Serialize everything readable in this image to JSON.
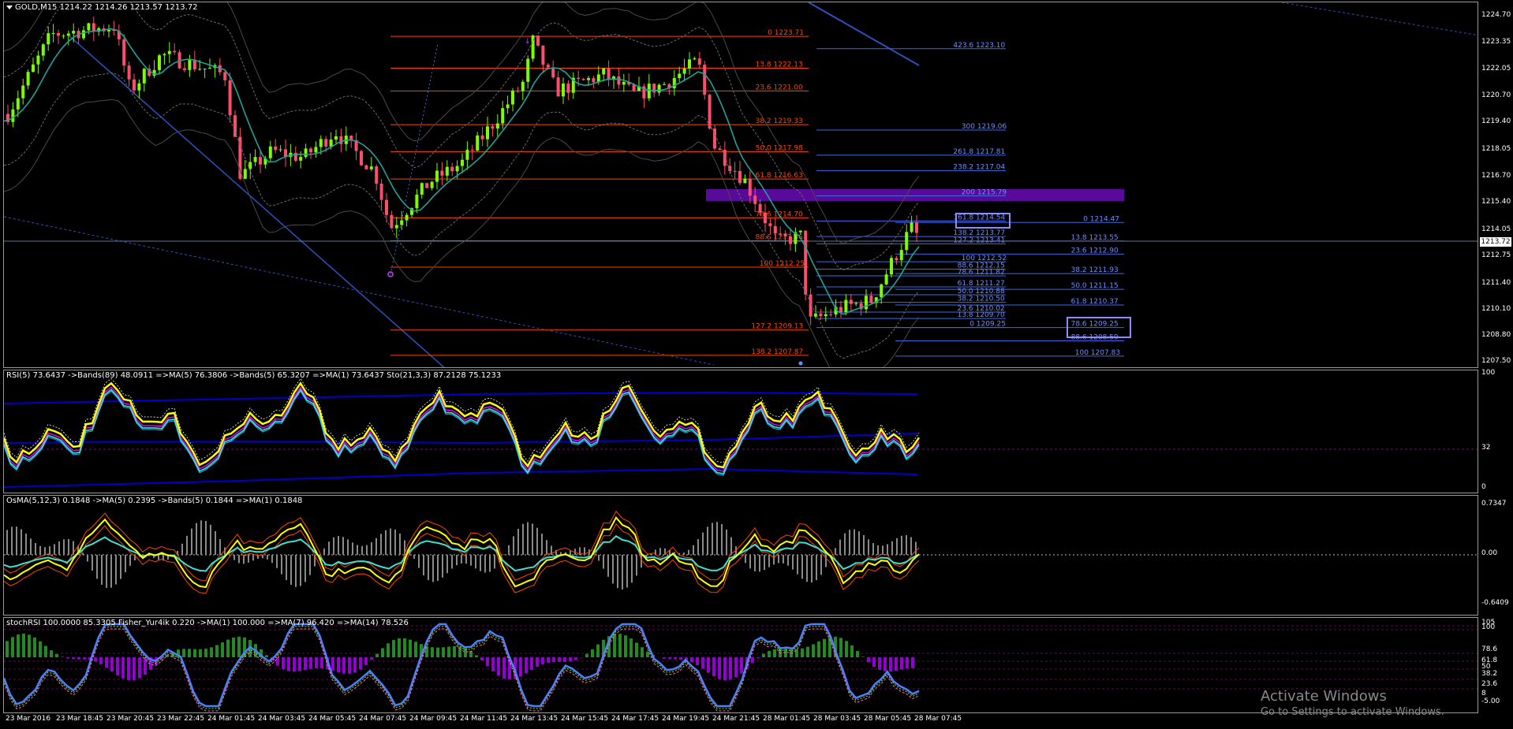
{
  "chart_header": "GOLD,M15  1214.22 1214.26 1213.57 1213.72",
  "current_price": "1213.72",
  "price_axis": [
    "1224.70",
    "1223.35",
    "1222.05",
    "1220.70",
    "1219.40",
    "1218.05",
    "1216.70",
    "1215.40",
    "1214.05",
    "1212.75",
    "1211.40",
    "1210.10",
    "1208.80",
    "1207.50"
  ],
  "fib_orange": [
    {
      "label": "0 1223.71"
    },
    {
      "label": "13.8 1222.13"
    },
    {
      "label": "23.6 1221.00"
    },
    {
      "label": "38.2 1219.33"
    },
    {
      "label": "50.0 1217.98"
    },
    {
      "label": "61.8 1216.63"
    },
    {
      "label": "78.6 1214.70"
    },
    {
      "label": "88.6 1213.56"
    },
    {
      "label": "100 1212.25"
    },
    {
      "label": "127.2 1209.13"
    },
    {
      "label": "138.2 1207.87"
    }
  ],
  "fib_blue_upper": [
    {
      "label": "423.6 1223.10"
    },
    {
      "label": "300 1219.06"
    },
    {
      "label": "261.8 1217.81"
    },
    {
      "label": "238.2 1217.04"
    },
    {
      "label": "200 1215.79"
    },
    {
      "label": "161.8 1214.54"
    },
    {
      "label": "138.2 1213.77"
    },
    {
      "label": "127.2 1213.41"
    },
    {
      "label": "100 1212.52"
    },
    {
      "label": "88.6 1212.15"
    },
    {
      "label": "78.6 1211.82"
    },
    {
      "label": "61.8 1211.27"
    },
    {
      "label": "50.0 1210.88"
    },
    {
      "label": "38.2 1210.50"
    },
    {
      "label": "23.6 1210.02"
    },
    {
      "label": "13.8 1209.70"
    },
    {
      "label": "0 1209.25"
    }
  ],
  "fib_blue_right": [
    {
      "label": "0 1214.47"
    },
    {
      "label": "13.8 1213.55"
    },
    {
      "label": "23.6 1212.90"
    },
    {
      "label": "38.2 1211.93"
    },
    {
      "label": "50.0 1211.15"
    },
    {
      "label": "61.8 1210.37"
    },
    {
      "label": "78.6 1209.25"
    },
    {
      "label": "88.6 1208.59"
    },
    {
      "label": "100 1207.83"
    }
  ],
  "rsi_panel": {
    "header": "RSI(5) 73.6437  ->Bands(89) 48.0911  =>MA(5) 76.3806  ->Bands(5) 65.3207  =>MA(1) 73.6437  Sto(21,3,3) 87.2128 75.1233",
    "axis": [
      "100",
      "32",
      "0"
    ]
  },
  "osma_panel": {
    "header": "OsMA(5,12,3) 0.1848  ->MA(5) 0.2395  ->Bands(5) 0.1844  =>MA(1) 0.1848",
    "axis": [
      "0.7347",
      "0.00",
      "-0.6409"
    ]
  },
  "stoch_panel": {
    "header": "stochRSI 100.0000 85.3305  Fisher_Yur4ik 0.220  ->MA(1) 100.000  =>MA(7) 96.420  =>MA(14) 78.526",
    "axis": [
      "105",
      "100",
      "78.6",
      "61.8",
      "50",
      "38.2",
      "23.6",
      "8",
      "-5.00"
    ]
  },
  "time_axis": [
    "23 Mar 2016",
    "23 Mar 18:45",
    "23 Mar 20:45",
    "23 Mar 22:45",
    "24 Mar 01:45",
    "24 Mar 03:45",
    "24 Mar 05:45",
    "24 Mar 07:45",
    "24 Mar 09:45",
    "24 Mar 11:45",
    "24 Mar 13:45",
    "24 Mar 15:45",
    "24 Mar 17:45",
    "24 Mar 19:45",
    "24 Mar 21:45",
    "28 Mar 01:45",
    "28 Mar 03:45",
    "28 Mar 05:45",
    "28 Mar 07:45"
  ],
  "watermark": {
    "line1": "Activate Windows",
    "line2": "Go to Settings to activate Windows."
  },
  "colors": {
    "up": "#7CFC00",
    "down": "#ff4d6d",
    "fib_orange": "#ff4500",
    "fib_blue": "#4169e1",
    "rsi_main": "#ffff00",
    "band": "#0000cd",
    "purple_zone": "#5a0a9a"
  }
}
